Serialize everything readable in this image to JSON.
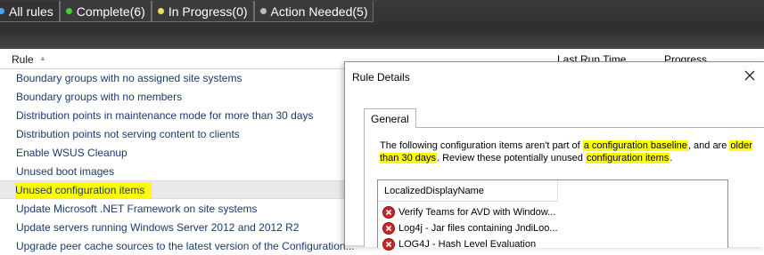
{
  "filter_tabs": [
    {
      "label": "All rules",
      "dot_color": "#4ea0ff"
    },
    {
      "label": "Complete(6)",
      "dot_color": "#44cc33"
    },
    {
      "label": "In Progress(0)",
      "dot_color": "#f4e04d"
    },
    {
      "label": "Action Needed(5)",
      "dot_color": "#bdbdbd"
    }
  ],
  "list": {
    "columns": {
      "rule": "Rule",
      "last_run": "Last Run Time",
      "progress": "Progress"
    },
    "rows": [
      "Boundary groups with no assigned site systems",
      "Boundary groups with no members",
      "Distribution points in maintenance mode for more than 30 days",
      "Distribution points not serving content to clients",
      "Enable WSUS Cleanup",
      "Unused boot images",
      "Unused configuration items",
      "Update Microsoft .NET Framework on site systems",
      "Update servers running Windows Server 2012 and 2012 R2",
      "Upgrade peer cache sources to the latest version of the Configuration..."
    ],
    "selected_row": "Unused configuration items"
  },
  "dialog": {
    "title": "Rule Details",
    "tab": "General",
    "description": {
      "p1": "The following configuration items aren't part of ",
      "h1": "a configuration baseline",
      "p2": ", and are ",
      "h2": "older than 30 days",
      "p3": ". Review these potentially unused ",
      "h3": "configuration items",
      "p4": "."
    },
    "grid": {
      "column": "LocalizedDisplayName",
      "rows": [
        "Verify Teams for AVD with Window...",
        "Log4j - Jar files containing JndiLoo...",
        "LOG4J - Hash Level Evaluation"
      ]
    }
  },
  "colors": {
    "highlight": "#ffff00",
    "link_text": "#1a3a6e",
    "error_icon": "#c62828"
  }
}
